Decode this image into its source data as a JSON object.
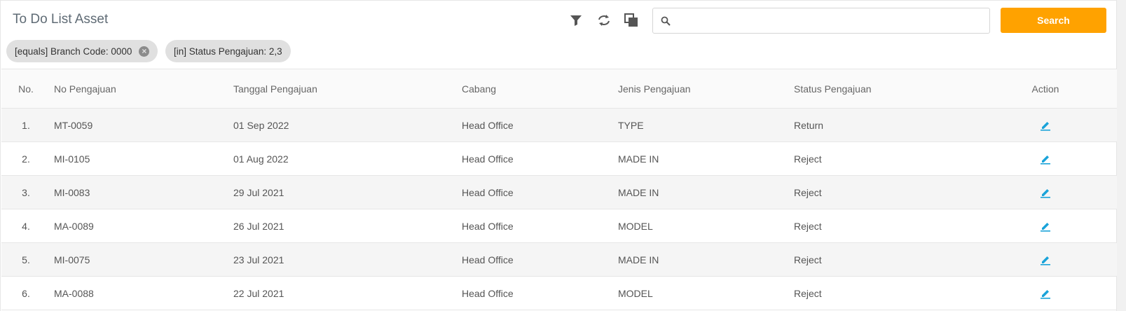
{
  "header": {
    "title": "To Do List Asset",
    "search_placeholder": "",
    "search_value": "",
    "search_button_label": "Search"
  },
  "toolbar_icons": [
    "filter-icon",
    "refresh-icon",
    "copy-icon"
  ],
  "filters": [
    {
      "label": "[equals] Branch Code: 0000",
      "removable": true
    },
    {
      "label": "[in] Status Pengajuan: 2,3",
      "removable": false
    }
  ],
  "table": {
    "columns": [
      "No.",
      "No Pengajuan",
      "Tanggal Pengajuan",
      "Cabang",
      "Jenis Pengajuan",
      "Status Pengajuan",
      "Action"
    ],
    "rows": [
      {
        "no": "1.",
        "no_pengajuan": "MT-0059",
        "tanggal": "01 Sep 2022",
        "cabang": "Head Office",
        "jenis": "TYPE",
        "status": "Return"
      },
      {
        "no": "2.",
        "no_pengajuan": "MI-0105",
        "tanggal": "01 Aug 2022",
        "cabang": "Head Office",
        "jenis": "MADE IN",
        "status": "Reject"
      },
      {
        "no": "3.",
        "no_pengajuan": "MI-0083",
        "tanggal": "29 Jul 2021",
        "cabang": "Head Office",
        "jenis": "MADE IN",
        "status": "Reject"
      },
      {
        "no": "4.",
        "no_pengajuan": "MA-0089",
        "tanggal": "26 Jul 2021",
        "cabang": "Head Office",
        "jenis": "MODEL",
        "status": "Reject"
      },
      {
        "no": "5.",
        "no_pengajuan": "MI-0075",
        "tanggal": "23 Jul 2021",
        "cabang": "Head Office",
        "jenis": "MADE IN",
        "status": "Reject"
      },
      {
        "no": "6.",
        "no_pengajuan": "MA-0088",
        "tanggal": "22 Jul 2021",
        "cabang": "Head Office",
        "jenis": "MODEL",
        "status": "Reject"
      }
    ]
  },
  "colors": {
    "accent": "#ffa200",
    "edit_icon": "#1aa3d9",
    "icon_gray": "#555555",
    "chip_bg": "#e0e0e0"
  }
}
